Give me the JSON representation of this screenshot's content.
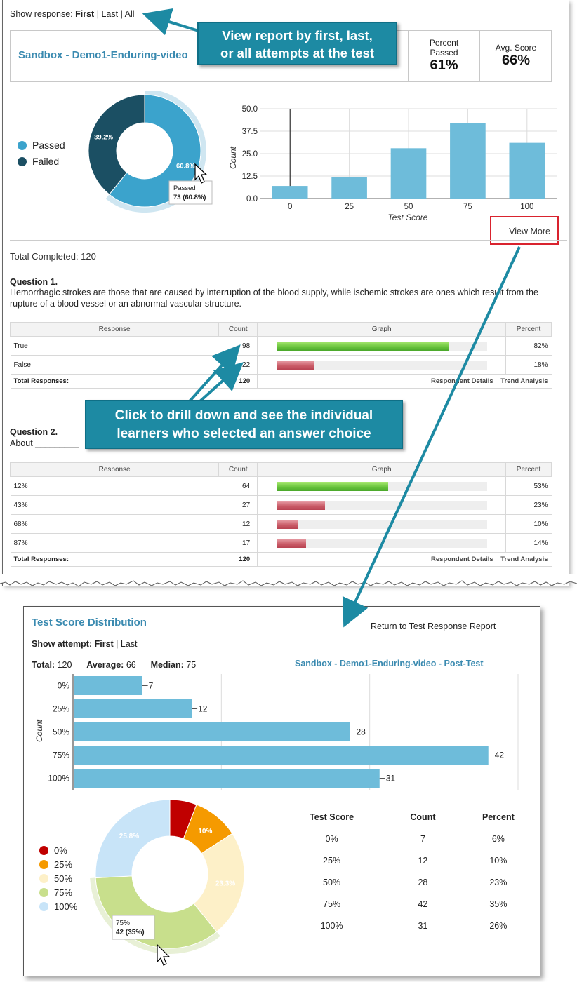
{
  "show_response": {
    "label": "Show response:",
    "first": "First",
    "last": "Last",
    "all": "All",
    "sep": "|"
  },
  "header": {
    "title": "Sandbox - Demo1-Enduring-video",
    "percent_passed_label_1": "Percent",
    "percent_passed_label_2": "Passed",
    "percent_passed_value": "61%",
    "avg_score_label": "Avg. Score",
    "avg_score_value": "66%"
  },
  "callouts": {
    "top_line1": "View report by first, last,",
    "top_line2": "or all attempts at the test",
    "mid_line1": "Click to drill down and see the individual",
    "mid_line2": "learners who selected an answer choice"
  },
  "pass_fail": {
    "legend": [
      {
        "label": "Passed",
        "color": "#3ba3cc"
      },
      {
        "label": "Failed",
        "color": "#1b4f63"
      }
    ],
    "slices": [
      {
        "name": "Passed",
        "value": 73,
        "pct_label": "60.8%",
        "color": "#3ba3cc"
      },
      {
        "name": "Failed",
        "value": 47,
        "pct_label": "39.2%",
        "color": "#1b4f63"
      }
    ],
    "tooltip_line1": "Passed",
    "tooltip_line2": "73 (60.8%)"
  },
  "score_chart": {
    "ylabel": "Count",
    "xlabel": "Test Score",
    "yticks": [
      "50.0",
      "37.5",
      "25.0",
      "12.5",
      "0.0"
    ]
  },
  "view_more": "View More",
  "total_completed": "Total Completed: 120",
  "q1": {
    "title": "Question 1.",
    "text": "Hemorrhagic strokes are those that are caused by interruption of the blood supply, while ischemic strokes are ones which result from the rupture of a blood vessel or an abnormal vascular structure.",
    "headers": {
      "response": "Response",
      "count": "Count",
      "graph": "Graph",
      "percent": "Percent"
    },
    "rows": [
      {
        "response": "True",
        "count": "98",
        "percent": "82%",
        "fill": 0.82,
        "kind": "green"
      },
      {
        "response": "False",
        "count": "22",
        "percent": "18%",
        "fill": 0.18,
        "kind": "red"
      }
    ],
    "total_label": "Total Responses:",
    "total": "120",
    "respondent_details": "Respondent Details",
    "trend_analysis": "Trend Analysis"
  },
  "q2": {
    "title": "Question 2.",
    "text": "About _________",
    "headers": {
      "response": "Response",
      "count": "Count",
      "graph": "Graph",
      "percent": "Percent"
    },
    "rows": [
      {
        "response": "12%",
        "count": "64",
        "percent": "53%",
        "fill": 0.53,
        "kind": "green"
      },
      {
        "response": "43%",
        "count": "27",
        "percent": "23%",
        "fill": 0.23,
        "kind": "red"
      },
      {
        "response": "68%",
        "count": "12",
        "percent": "10%",
        "fill": 0.1,
        "kind": "red"
      },
      {
        "response": "87%",
        "count": "17",
        "percent": "14%",
        "fill": 0.14,
        "kind": "red"
      }
    ],
    "total_label": "Total Responses:",
    "total": "120",
    "respondent_details": "Respondent Details",
    "trend_analysis": "Trend Analysis"
  },
  "distribution": {
    "title": "Test Score Distribution",
    "return_link": "Return to Test Response Report",
    "show_attempt_label": "Show attempt:",
    "first": "First",
    "last": "Last",
    "total_label": "Total:",
    "total_value": "120",
    "average_label": "Average:",
    "average_value": "66",
    "median_label": "Median:",
    "median_value": "75",
    "subtitle": "Sandbox - Demo1-Enduring-video - Post-Test",
    "count_axis_label": "Count",
    "table_headers": [
      "Test Score",
      "Count",
      "Percent"
    ],
    "table_rows": [
      [
        "0%",
        "7",
        "6%"
      ],
      [
        "25%",
        "12",
        "10%"
      ],
      [
        "50%",
        "28",
        "23%"
      ],
      [
        "75%",
        "42",
        "35%"
      ],
      [
        "100%",
        "31",
        "26%"
      ]
    ],
    "pie_legend": [
      {
        "label": "0%",
        "color": "#c00000"
      },
      {
        "label": "25%",
        "color": "#f59a00"
      },
      {
        "label": "50%",
        "color": "#fdf0c8"
      },
      {
        "label": "75%",
        "color": "#c8df8c"
      },
      {
        "label": "100%",
        "color": "#c8e4f8"
      }
    ],
    "pie_tooltip_line1": "75%",
    "pie_tooltip_line2": "42 (35%)"
  },
  "chart_data": [
    {
      "type": "pie",
      "title": "",
      "categories": [
        "Passed",
        "Failed"
      ],
      "values": [
        73,
        47
      ],
      "labels": [
        "60.8%",
        "39.2%"
      ]
    },
    {
      "type": "bar",
      "title": "",
      "categories": [
        "0",
        "25",
        "50",
        "75",
        "100"
      ],
      "values": [
        7,
        12,
        28,
        42,
        31
      ],
      "xlabel": "Test Score",
      "ylabel": "Count",
      "ylim": [
        0,
        50
      ],
      "yticks": [
        0,
        12.5,
        25,
        37.5,
        50
      ],
      "grid": true
    },
    {
      "type": "bar",
      "orientation": "horizontal",
      "title": "",
      "categories": [
        "0%",
        "25%",
        "50%",
        "75%",
        "100%"
      ],
      "values": [
        7,
        12,
        28,
        42,
        31
      ],
      "ylabel": "Count",
      "xlim": [
        0,
        45
      ],
      "data_labels": [
        "7",
        "12",
        "28",
        "42",
        "31"
      ]
    },
    {
      "type": "pie",
      "title": "",
      "categories": [
        "0%",
        "25%",
        "50%",
        "75%",
        "100%"
      ],
      "values": [
        7,
        12,
        28,
        42,
        31
      ],
      "labels": [
        "",
        "10%",
        "23.3%",
        "",
        "25.8%"
      ],
      "legend": "left"
    }
  ]
}
